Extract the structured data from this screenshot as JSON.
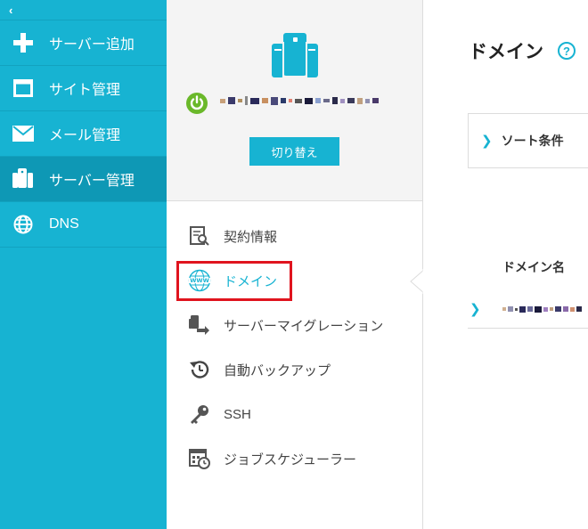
{
  "sidebar": {
    "collapse_glyph": "‹",
    "items": [
      {
        "label": "サーバー追加",
        "icon": "plus-icon"
      },
      {
        "label": "サイト管理",
        "icon": "window-icon"
      },
      {
        "label": "メール管理",
        "icon": "mail-icon"
      },
      {
        "label": "サーバー管理",
        "icon": "server-icon",
        "active": true
      },
      {
        "label": "DNS",
        "icon": "globe-icon"
      }
    ]
  },
  "server_panel": {
    "switch_label": "切り替え",
    "status": "online"
  },
  "menu": {
    "items": [
      {
        "label": "契約情報",
        "icon": "contract-icon"
      },
      {
        "label": "ドメイン",
        "icon": "www-icon",
        "active": true
      },
      {
        "label": "サーバーマイグレーション",
        "icon": "migration-icon"
      },
      {
        "label": "自動バックアップ",
        "icon": "backup-clock-icon"
      },
      {
        "label": "SSH",
        "icon": "key-icon"
      },
      {
        "label": "ジョブスケジューラー",
        "icon": "calendar-clock-icon"
      }
    ]
  },
  "content": {
    "title": "ドメイン",
    "help_glyph": "?",
    "sort_label": "ソート条件",
    "column_header": "ドメイン名",
    "row_chevron": "›"
  },
  "colors": {
    "accent": "#17b3d2",
    "accent_dark": "#0e98b5",
    "highlight": "#e0141e",
    "power": "#6ab82a"
  }
}
